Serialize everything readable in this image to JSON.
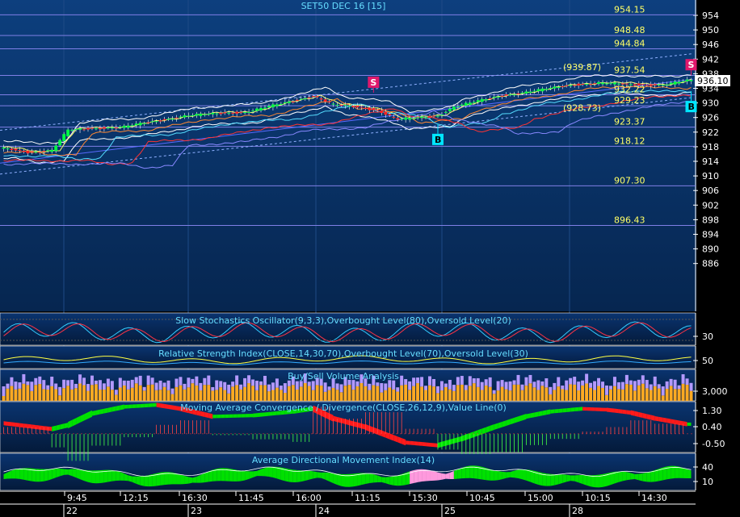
{
  "colors": {
    "background_top": "#0d3f7e",
    "background_bottom": "#062650",
    "panel_bg": "#041a3a",
    "grid": "#1e4a86",
    "level_line": "#7f7fe6",
    "level_label": "#ffff66",
    "title": "#66ddff",
    "axis_text": "#ffffff",
    "candle_up": "#00ff44",
    "candle_down": "#ff2222",
    "sell_signal": "#e0186c",
    "buy_signal": "#00e5ff",
    "volume_up": "#ffaa22",
    "volume_down": "#b399ff",
    "macd_pos": "#00e000",
    "macd_neg": "#ff1a1a",
    "adx_pos": "#00e000",
    "adx_neg": "#ff99dd"
  },
  "chart_data": [
    {
      "type": "candlestick",
      "panel": "price",
      "title": "SET50 DEC 16   [15]",
      "ylim": [
        882,
        956
      ],
      "y_ticks": [
        954,
        950,
        946,
        942,
        938,
        934,
        930,
        926,
        922,
        918,
        914,
        910,
        906,
        902,
        898,
        894,
        890,
        886
      ],
      "last_price": "936.10",
      "levels": [
        "954.15",
        "948.48",
        "944.84",
        "937.54",
        "932.22",
        "929.23",
        "923.37",
        "918.12",
        "907.30",
        "896.43"
      ],
      "level_values": [
        954.15,
        948.48,
        944.84,
        937.54,
        932.22,
        929.23,
        923.37,
        918.12,
        907.3,
        896.43
      ],
      "annotations": [
        "(939.87)",
        "(928.73)"
      ],
      "annotation_values": [
        939.87,
        928.73
      ],
      "signals": [
        {
          "label": "S",
          "type": "sell",
          "bar": 92,
          "price": 932.8
        },
        {
          "label": "B",
          "type": "buy",
          "bar": 108,
          "price": 924.2
        },
        {
          "label": "S",
          "type": "sell",
          "bar": 171,
          "price": 937.6
        },
        {
          "label": "B",
          "type": "buy",
          "bar": 171,
          "price": 933.2
        }
      ],
      "close_path": [
        [
          0,
          917.5
        ],
        [
          6,
          916.5
        ],
        [
          12,
          917.0
        ],
        [
          16,
          922.5
        ],
        [
          22,
          923.0
        ],
        [
          30,
          923.5
        ],
        [
          38,
          925.0
        ],
        [
          45,
          926.5
        ],
        [
          52,
          927.0
        ],
        [
          60,
          927.5
        ],
        [
          66,
          929.0
        ],
        [
          72,
          930.5
        ],
        [
          77,
          932.0
        ],
        [
          82,
          929.5
        ],
        [
          88,
          928.8
        ],
        [
          93,
          928.0
        ],
        [
          98,
          925.5
        ],
        [
          104,
          926.0
        ],
        [
          108,
          926.5
        ],
        [
          112,
          929.0
        ],
        [
          118,
          930.5
        ],
        [
          124,
          932.0
        ],
        [
          130,
          933.0
        ],
        [
          136,
          934.0
        ],
        [
          142,
          935.0
        ],
        [
          148,
          935.5
        ],
        [
          156,
          935.0
        ],
        [
          164,
          935.0
        ],
        [
          170,
          936.1
        ]
      ]
    },
    {
      "type": "line",
      "panel": "stochastic",
      "title": "Slow Stochastics Oscillator(9,3,3),Overbought Level(80),Oversold Level(20)",
      "y_ticks": [
        "30"
      ]
    },
    {
      "type": "line",
      "panel": "rsi",
      "title": "Relative Strength Index(CLOSE,14,30,70),Overbought Level(70),Oversold Level(30)",
      "y_ticks": [
        "50"
      ]
    },
    {
      "type": "bar",
      "panel": "volume",
      "title": "Buy/Sell Volume Analysis",
      "y_ticks": [
        "3,000"
      ]
    },
    {
      "type": "area",
      "panel": "macd",
      "title": "Moving Average Convergence / Divergence(CLOSE,26,12,9),Value Line(0)",
      "y_ticks": [
        "1.30",
        "0.40",
        "-0.50"
      ],
      "ylim": [
        -0.75,
        1.55
      ],
      "path": [
        [
          0,
          0.6
        ],
        [
          12,
          0.3
        ],
        [
          16,
          0.5
        ],
        [
          22,
          1.1
        ],
        [
          30,
          1.45
        ],
        [
          38,
          1.55
        ],
        [
          44,
          1.35
        ],
        [
          52,
          0.95
        ],
        [
          62,
          1.0
        ],
        [
          72,
          1.2
        ],
        [
          77,
          1.35
        ],
        [
          82,
          0.85
        ],
        [
          90,
          0.4
        ],
        [
          100,
          -0.4
        ],
        [
          108,
          -0.55
        ],
        [
          114,
          -0.2
        ],
        [
          122,
          0.4
        ],
        [
          130,
          0.95
        ],
        [
          136,
          1.2
        ],
        [
          144,
          1.35
        ],
        [
          150,
          1.3
        ],
        [
          156,
          1.15
        ],
        [
          162,
          0.85
        ],
        [
          170,
          0.55
        ]
      ]
    },
    {
      "type": "area",
      "panel": "adx",
      "title": "Average Directional Movement Index(14)",
      "y_ticks": [
        "40",
        "10"
      ]
    }
  ],
  "x_axis": {
    "times": [
      "9:45",
      "12:15",
      "16:30",
      "11:45",
      "16:00",
      "11:15",
      "15:30",
      "10:45",
      "15:00",
      "10:15",
      "14:30"
    ],
    "days": [
      "22",
      "23",
      "24",
      "25",
      "28"
    ]
  }
}
